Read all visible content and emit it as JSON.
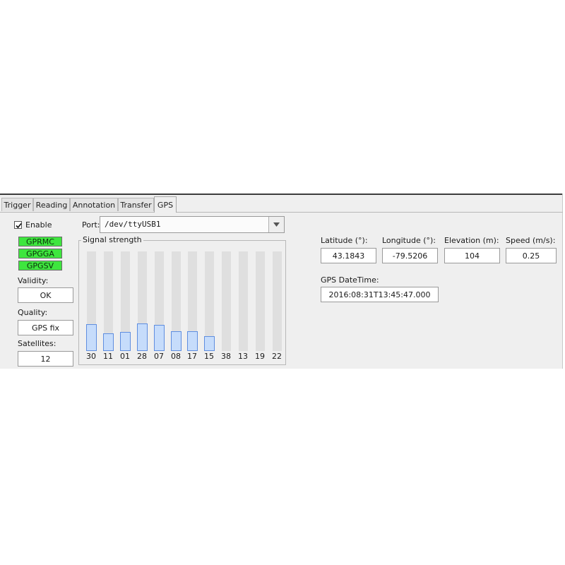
{
  "tabs": [
    {
      "label": "Trigger"
    },
    {
      "label": "Reading"
    },
    {
      "label": "Annotation"
    },
    {
      "label": "Transfer"
    },
    {
      "label": "GPS"
    }
  ],
  "enable": {
    "label": "Enable",
    "checked": true
  },
  "sentences": [
    "GPRMC",
    "GPGGA",
    "GPGSV"
  ],
  "validity": {
    "label": "Validity:",
    "value": "OK"
  },
  "quality": {
    "label": "Quality:",
    "value": "GPS fix"
  },
  "satellites": {
    "label": "Satellites:",
    "value": "12"
  },
  "port": {
    "label": "Port:",
    "value": "/dev/ttyUSB1"
  },
  "signal": {
    "title": "Signal strength",
    "satellites": [
      {
        "prn": "30",
        "strength": 0.27
      },
      {
        "prn": "11",
        "strength": 0.18
      },
      {
        "prn": "01",
        "strength": 0.19
      },
      {
        "prn": "28",
        "strength": 0.28
      },
      {
        "prn": "07",
        "strength": 0.26
      },
      {
        "prn": "08",
        "strength": 0.2
      },
      {
        "prn": "17",
        "strength": 0.2
      },
      {
        "prn": "15",
        "strength": 0.15
      },
      {
        "prn": "38",
        "strength": 0
      },
      {
        "prn": "13",
        "strength": 0
      },
      {
        "prn": "19",
        "strength": 0
      },
      {
        "prn": "22",
        "strength": 0
      }
    ]
  },
  "position": {
    "latitude": {
      "label": "Latitude (°):",
      "value": "43.1843"
    },
    "longitude": {
      "label": "Longitude (°):",
      "value": "-79.5206"
    },
    "elevation": {
      "label": "Elevation (m):",
      "value": "104"
    },
    "speed": {
      "label": "Speed (m/s):",
      "value": "0.25"
    }
  },
  "datetime": {
    "label": "GPS DateTime:",
    "value": "2016:08:31T13:45:47.000"
  }
}
